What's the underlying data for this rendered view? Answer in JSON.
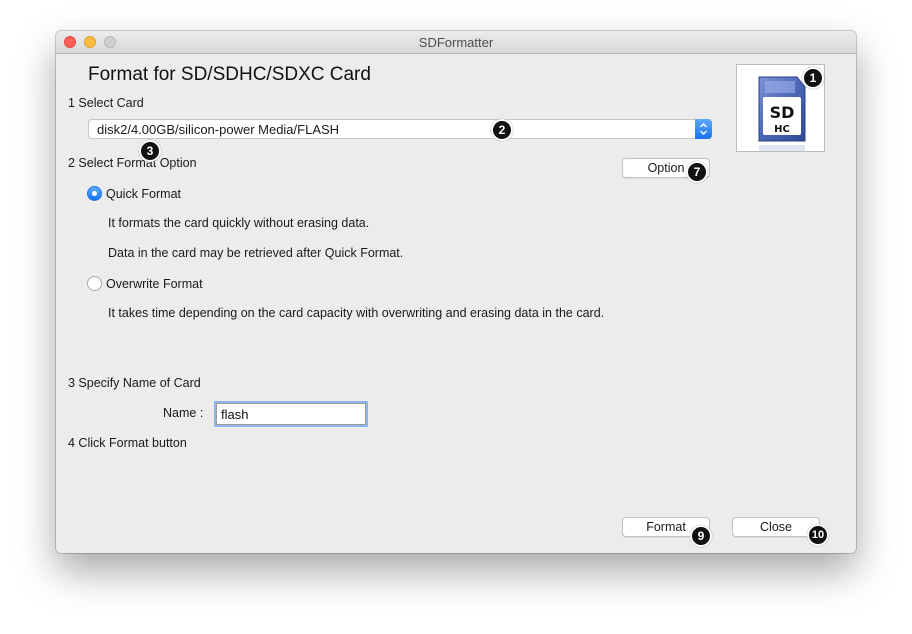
{
  "window": {
    "title": "SDFormatter"
  },
  "heading": "Format for SD/SDHC/SDXC Card",
  "step1": {
    "label": "1 Select Card",
    "card_value": "disk2/4.00GB/silicon-power Media/FLASH"
  },
  "step2": {
    "label": "2 Select Format Option",
    "option_button": "Option",
    "quick_format": {
      "label": "Quick Format",
      "selected": true,
      "desc1": "It formats the card quickly without erasing data.",
      "desc2": "Data in the card may be retrieved after Quick Format."
    },
    "overwrite_format": {
      "label": "Overwrite Format",
      "selected": false,
      "desc": "It takes time depending on the card capacity with overwriting and erasing data in the card."
    }
  },
  "step3": {
    "label": "3 Specify Name of Card",
    "name_label": "Name :",
    "name_value": "flash"
  },
  "step4": {
    "label": "4 Click Format button"
  },
  "buttons": {
    "format": "Format",
    "close": "Close"
  },
  "logo": {
    "text": "SD",
    "subtext": "HC"
  },
  "markers": [
    "1",
    "2",
    "3",
    "7",
    "9",
    "10"
  ],
  "colors": {
    "accent": "#1673f0",
    "marker": "#111111"
  }
}
